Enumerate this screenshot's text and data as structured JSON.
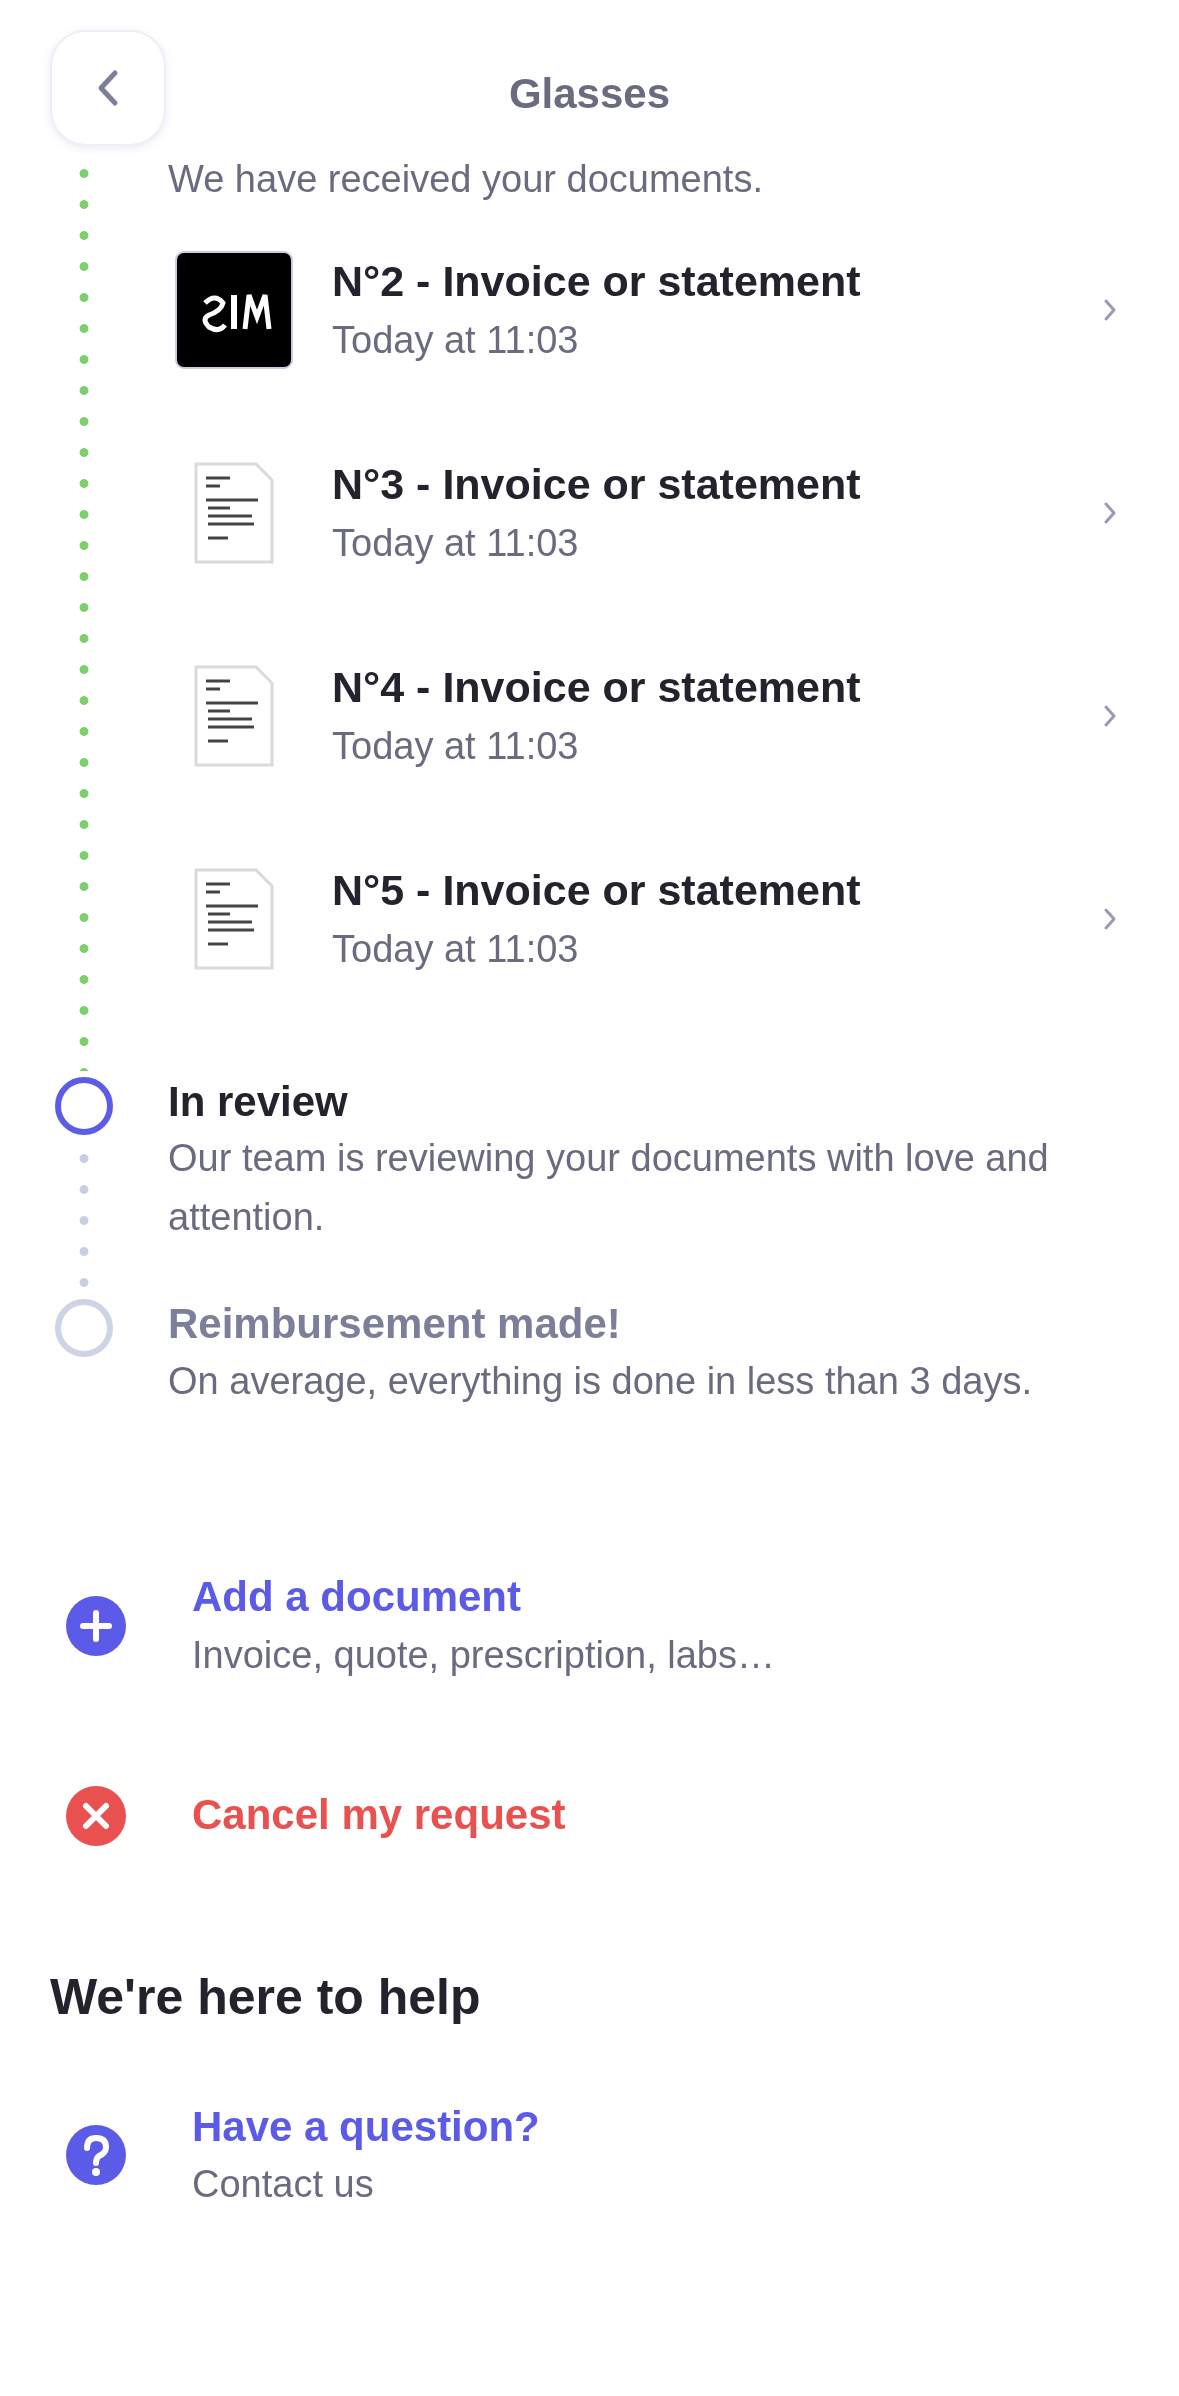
{
  "header": {
    "title": "Glasses"
  },
  "timeline": [
    {
      "completed": true,
      "description": "We have received your documents.",
      "documents": [
        {
          "kind": "picture",
          "title": "N°2 - Invoice or statement",
          "time": "Today at 11:03"
        },
        {
          "kind": "document",
          "title": "N°3 - Invoice or statement",
          "time": "Today at 11:03"
        },
        {
          "kind": "document",
          "title": "N°4 - Invoice or statement",
          "time": "Today at 11:03"
        },
        {
          "kind": "document",
          "title": "N°5 - Invoice or statement",
          "time": "Today at 11:03"
        }
      ]
    },
    {
      "completed": false,
      "active": true,
      "title": "In review",
      "description": "Our team is reviewing your documents with love and attention."
    },
    {
      "completed": false,
      "active": false,
      "title": "Reimbursement made!",
      "description": "On average, everything is done in less than 3 days."
    }
  ],
  "actions": [
    {
      "kind": "add",
      "title": "Add a document",
      "subtitle": "Invoice, quote, prescription, labs…"
    },
    {
      "kind": "cancel",
      "title": "Cancel my request"
    }
  ],
  "help": {
    "heading": "We're here to help",
    "items": [
      {
        "kind": "question",
        "title": "Have a question?",
        "subtitle": "Contact us"
      }
    ]
  }
}
